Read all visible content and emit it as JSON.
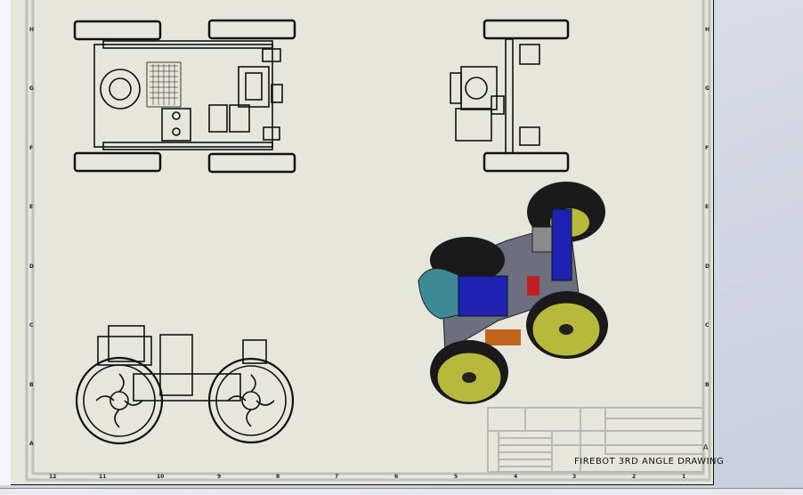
{
  "drawing": {
    "title": "FIREBOT 3RD ANGLE DRAWING",
    "sheet_rev_letter": "A"
  },
  "zones": {
    "rows": [
      "H",
      "G",
      "F",
      "E",
      "D",
      "C",
      "B",
      "A"
    ],
    "columns": [
      "12",
      "11",
      "10",
      "9",
      "8",
      "7",
      "6",
      "5",
      "4",
      "3",
      "2",
      "1"
    ]
  },
  "colors": {
    "sheet": "#e6e6dc",
    "border": "#c0c0c0",
    "chassis": "#6b6f80",
    "bracket_blue": "#1e22b0",
    "wheel_rim": "#b8b83a",
    "tire": "#1a1a1a",
    "motor": "#3d8a96",
    "accent_orange": "#c0651a",
    "accent_red": "#c02020"
  }
}
